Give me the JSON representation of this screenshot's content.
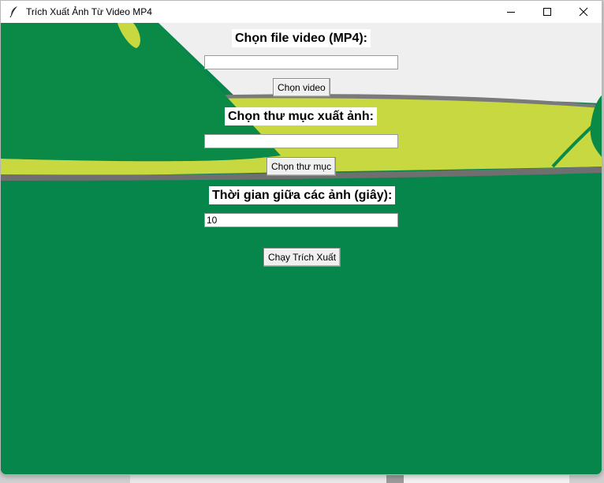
{
  "window": {
    "title": "Trích Xuất Ảnh Từ Video MP4",
    "icons": [
      "feather-icon",
      "minimize-icon",
      "maximize-icon",
      "close-icon"
    ]
  },
  "form": {
    "video_label": "Chọn file video (MP4):",
    "video_path_value": "",
    "choose_video_button": "Chọn video",
    "output_label": "Chọn thư mục xuất ảnh:",
    "output_path_value": "",
    "choose_folder_button": "Chọn thư mục",
    "interval_label": "Thời gian giữa các ảnh (giây):",
    "interval_value": "10",
    "run_button": "Chạy Trích Xuất"
  },
  "colors": {
    "dark_green": "#06864a",
    "lime": "#c8d840",
    "light_band": "#efefef"
  }
}
